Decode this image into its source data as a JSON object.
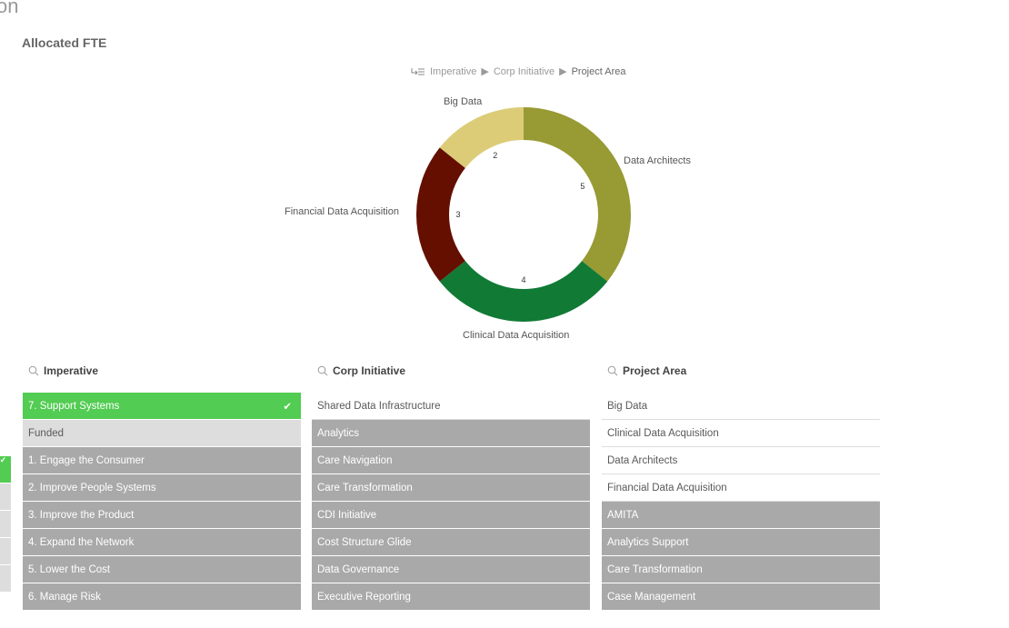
{
  "page_title_fragment": "on",
  "chart_title": "Allocated FTE",
  "breadcrumb": [
    "Imperative",
    "Corp Initiative",
    "Project Area"
  ],
  "chart_data": {
    "type": "pie",
    "variant": "donut",
    "slices": [
      {
        "label": "Data Architects",
        "value": 5,
        "color": "#989a33"
      },
      {
        "label": "Clinical Data Acquisition",
        "value": 4,
        "color": "#117a35"
      },
      {
        "label": "Financial Data Acquisition",
        "value": 3,
        "color": "#640f00"
      },
      {
        "label": "Big Data",
        "value": 2,
        "color": "#dccc78"
      }
    ]
  },
  "filters": [
    {
      "title": "Imperative",
      "icon": "search-icon",
      "items": [
        {
          "label": "7. Support Systems",
          "state": "selected"
        },
        {
          "label": "Funded",
          "state": "alternative"
        },
        {
          "label": "1. Engage the Consumer",
          "state": "excluded"
        },
        {
          "label": "2. Improve People Systems",
          "state": "excluded"
        },
        {
          "label": "3. Improve the Product",
          "state": "excluded"
        },
        {
          "label": "4. Expand the Network",
          "state": "excluded"
        },
        {
          "label": "5. Lower the Cost",
          "state": "excluded"
        },
        {
          "label": "6. Manage Risk",
          "state": "excluded"
        }
      ]
    },
    {
      "title": "Corp Initiative",
      "icon": "search-icon",
      "items": [
        {
          "label": "Shared Data Infrastructure",
          "state": "possible"
        },
        {
          "label": "Analytics",
          "state": "excluded"
        },
        {
          "label": "Care Navigation",
          "state": "excluded"
        },
        {
          "label": "Care Transformation",
          "state": "excluded"
        },
        {
          "label": "CDI Initiative",
          "state": "excluded"
        },
        {
          "label": "Cost Structure Glide",
          "state": "excluded"
        },
        {
          "label": "Data Governance",
          "state": "excluded"
        },
        {
          "label": "Executive Reporting",
          "state": "excluded"
        }
      ]
    },
    {
      "title": "Project Area",
      "icon": "search-icon",
      "items": [
        {
          "label": "Big Data",
          "state": "possible"
        },
        {
          "label": "Clinical Data Acquisition",
          "state": "possible"
        },
        {
          "label": "Data Architects",
          "state": "possible"
        },
        {
          "label": "Financial Data Acquisition",
          "state": "possible"
        },
        {
          "label": "AMITA",
          "state": "excluded"
        },
        {
          "label": "Analytics Support",
          "state": "excluded"
        },
        {
          "label": "Care Transformation",
          "state": "excluded"
        },
        {
          "label": "Case Management",
          "state": "excluded"
        }
      ]
    }
  ]
}
